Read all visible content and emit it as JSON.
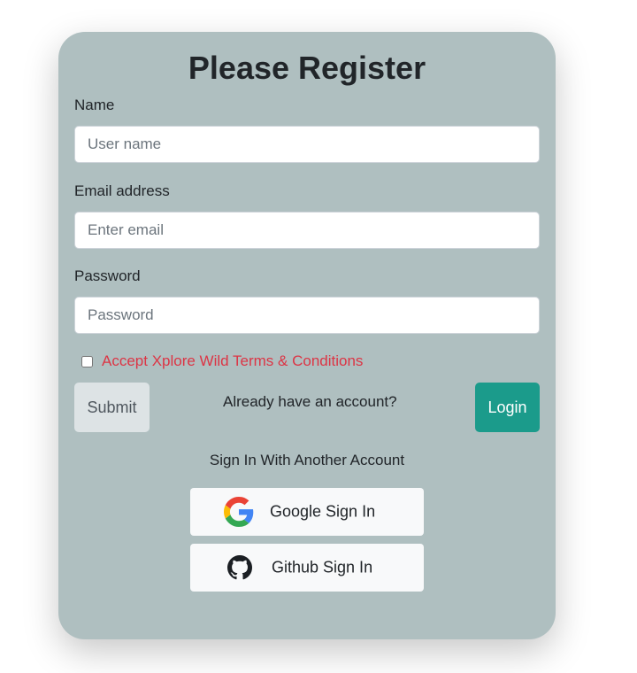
{
  "form": {
    "title": "Please Register",
    "name_label": "Name",
    "name_placeholder": "User name",
    "name_value": "",
    "email_label": "Email address",
    "email_placeholder": "Enter email",
    "email_value": "",
    "password_label": "Password",
    "password_placeholder": "Password",
    "password_value": "",
    "terms_checked": false,
    "terms_text": "Accept Xplore Wild Terms & Conditions",
    "submit_label": "Submit",
    "already_text": "Already have an account?",
    "login_label": "Login"
  },
  "social": {
    "heading": "Sign In With Another Account",
    "google_label": "Google Sign In",
    "google_icon": "google-icon",
    "github_label": "Github Sign In",
    "github_icon": "github-icon"
  },
  "colors": {
    "card_bg": "#afbfc0",
    "terms_text": "#dc3545",
    "login_bg": "#1b9b8b",
    "submit_bg": "#dde3e5",
    "social_bg": "#f8f9fa"
  }
}
